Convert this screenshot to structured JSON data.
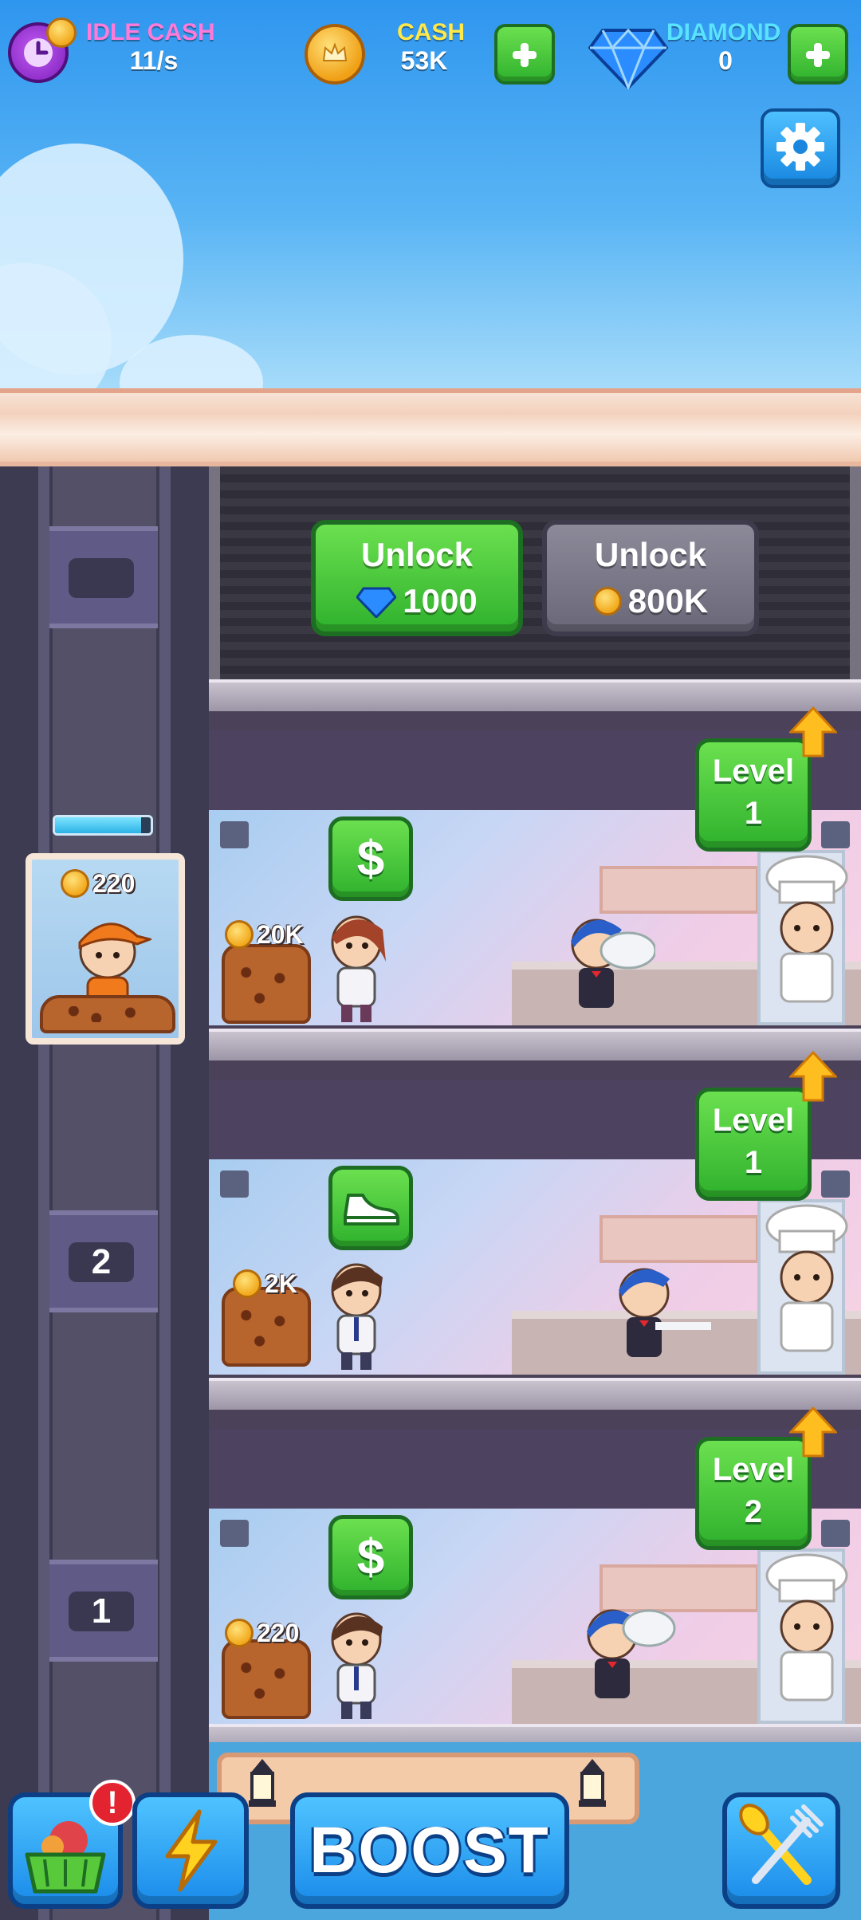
{
  "hud": {
    "idle_cash": {
      "label": "IDLE CASH",
      "value": "11/s"
    },
    "cash": {
      "label": "CASH",
      "value": "53K"
    },
    "diamond": {
      "label": "DIAMOND",
      "value": "0"
    }
  },
  "unlock": {
    "diamond": {
      "label": "Unlock",
      "price": "1000"
    },
    "cash": {
      "label": "Unlock",
      "price": "800K"
    }
  },
  "elevator": {
    "load": "220",
    "fill_percent": 90,
    "floor_signs": [
      "2",
      "1"
    ]
  },
  "floors": [
    {
      "stock": "20K",
      "manager_icon": "dollar-icon",
      "manager_symbol": "$",
      "level_label": "Level",
      "level": "1"
    },
    {
      "stock": "2K",
      "manager_icon": "sneaker-icon",
      "manager_symbol": "",
      "level_label": "Level",
      "level": "1"
    },
    {
      "stock": "220",
      "manager_icon": "dollar-icon",
      "manager_symbol": "$",
      "level_label": "Level",
      "level": "2"
    }
  ],
  "bottom_bar": {
    "boost_label": "BOOST",
    "shop_badge": "!"
  },
  "colors": {
    "idle_label": "#ff7ad9",
    "cash_label": "#ffe84a",
    "diamond_label": "#59e3ff",
    "green_button": "#2fb12d",
    "blue_button": "#1a8bea"
  }
}
